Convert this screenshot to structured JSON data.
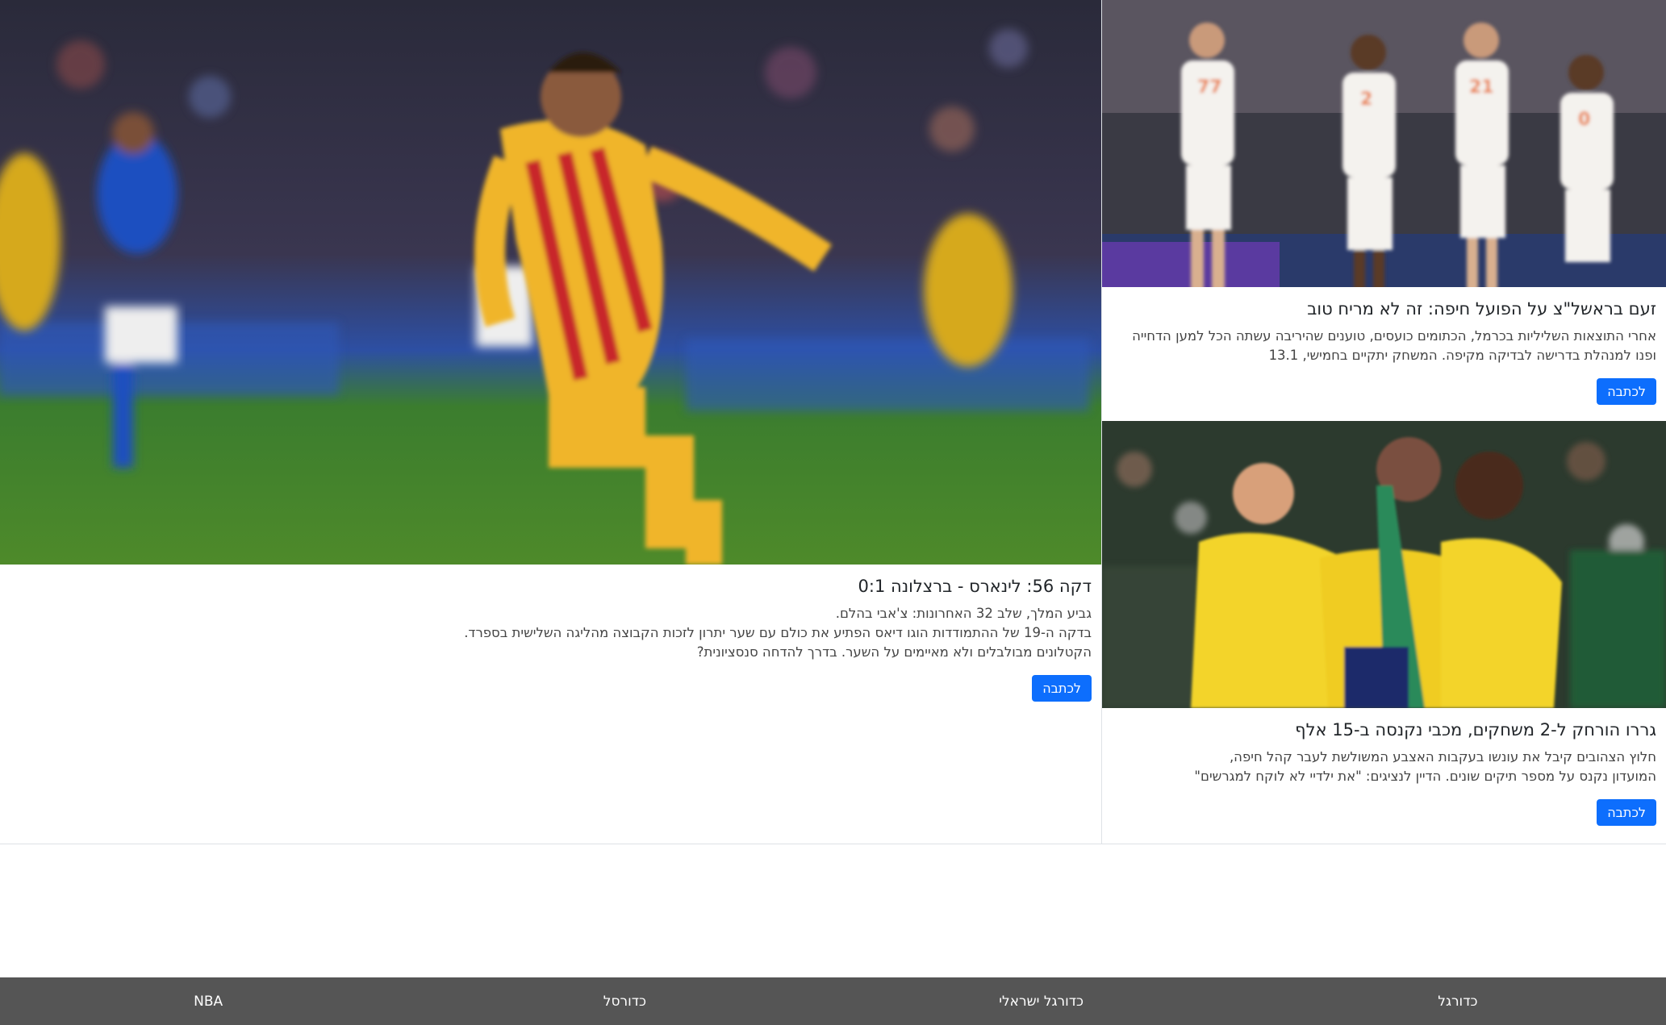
{
  "articles": {
    "main": {
      "title": "דקה 56: לינארס - ברצלונה 0:1",
      "lines": [
        "גביע המלך, שלב 32 האחרונות: צ'אבי בהלם.",
        "בדקה ה-19 של ההתמודדות הוגו דיאס הפתיע את כולם עם שער יתרון לזכות הקבוצה מהליגה השלישית בספרד.",
        "הקטלונים מבולבלים ולא מאיימים על השער. בדרך להדחה סנסציונית?"
      ],
      "button": "לכתבה",
      "image": "photo-football-player-barcelona"
    },
    "top": {
      "title": "זעם בראשל\"צ על הפועל חיפה: זה לא מריח טוב",
      "lines": [
        "אחרי התוצאות השליליות בכרמל, הכתומים כועסים, טוענים שהיריבה עשתה הכל למען הדחייה ופנו למנהלת בדרישה לבדיקה מקיפה. המשחק יתקיים בחמישי, 13.1"
      ],
      "button": "לכתבה",
      "image": "photo-basketball-team"
    },
    "bottom": {
      "title": "גררו הורחק ל-2 משחקים, מכבי נקנסה ב-15 אלף",
      "lines": [
        "חלוץ הצהובים קיבל את עונשו בעקבות האצבע המשולשת לעבר קהל חיפה,",
        "המועדון נקנס על מספר תיקים שונים. הדיין לנציגים: \"את ילדיי לא לוקח למגרשים\""
      ],
      "button": "לכתבה",
      "image": "photo-celebrating-players"
    }
  },
  "footer": {
    "items": [
      "כדורגל",
      "כדורגל ישראלי",
      "כדורסל",
      "NBA"
    ]
  },
  "colors": {
    "button": "#0d6efd",
    "footer": "#555555"
  }
}
